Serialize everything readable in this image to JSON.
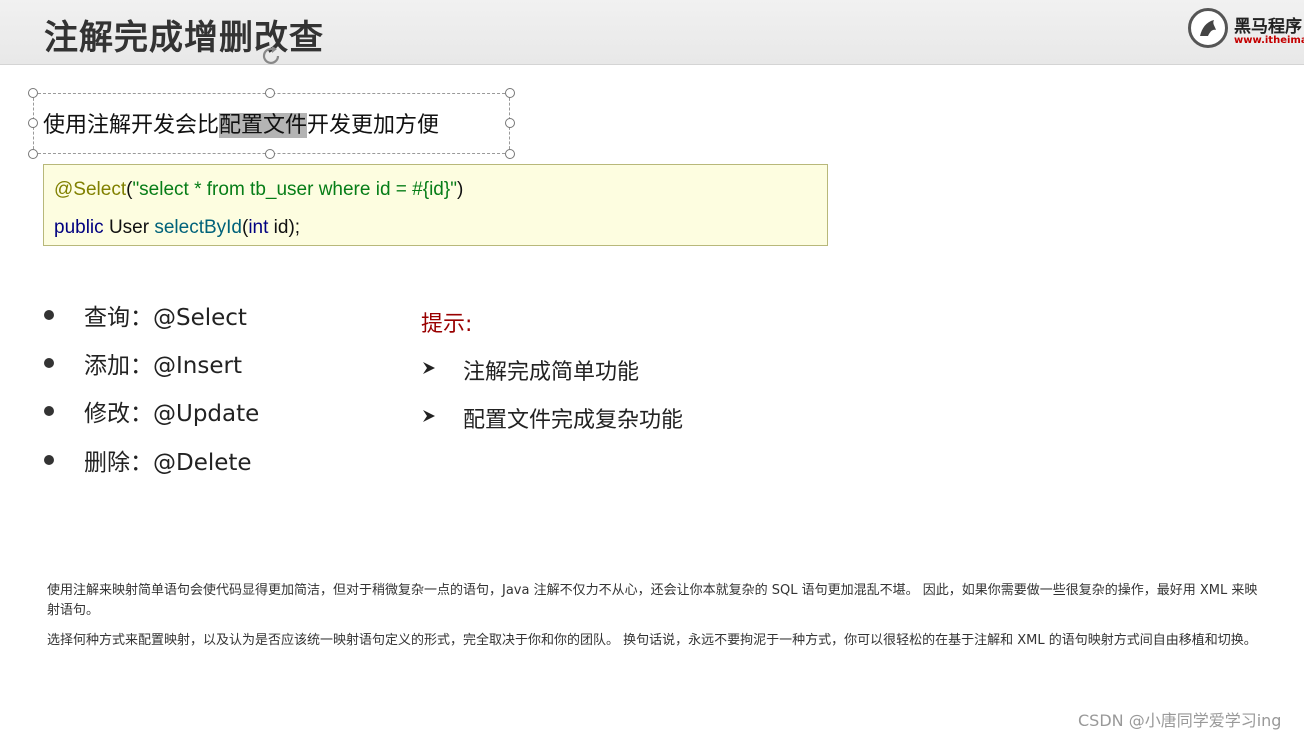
{
  "slide": {
    "title": "注解完成增删改查",
    "logo": {
      "name": "黑马程序",
      "url": "www.itheima.",
      "icon": "horse-logo-icon"
    },
    "intro": {
      "before": "使用注解开发会比",
      "highlight": "配置文件",
      "after": "开发更加方便"
    },
    "code": {
      "line1": {
        "annotation": "@Select",
        "open": "(",
        "string": "\"select * from tb_user where id = #{id}\"",
        "close": ")"
      },
      "line2": {
        "kw_public": "public",
        "type": "User",
        "method": "selectById",
        "open": "(",
        "kw_int": "int",
        "rest": " id);"
      }
    },
    "bullets": [
      {
        "text": "查询：@Select"
      },
      {
        "text": "添加：@Insert"
      },
      {
        "text": "修改：@Update"
      },
      {
        "text": "删除：@Delete"
      }
    ],
    "tips": {
      "title": "提示:",
      "items": [
        {
          "text": "注解完成简单功能"
        },
        {
          "text": "配置文件完成复杂功能"
        }
      ]
    },
    "paragraphs": [
      "使用注解来映射简单语句会使代码显得更加简洁，但对于稍微复杂一点的语句，Java 注解不仅力不从心，还会让你本就复杂的 SQL 语句更加混乱不堪。 因此，如果你需要做一些很复杂的操作，最好用 XML 来映射语句。",
      "选择何种方式来配置映射，以及认为是否应该统一映射语句定义的形式，完全取决于你和你的团队。 换句话说，永远不要拘泥于一种方式，你可以很轻松的在基于注解和 XML 的语句映射方式间自由移植和切换。"
    ]
  },
  "watermark": "CSDN @小唐同学爱学习ing",
  "colors": {
    "annotation": "#808000",
    "string": "#067d17",
    "keyword": "#000080",
    "method": "#00627a",
    "tip_title": "#990000",
    "code_bg": "#fdfde0"
  }
}
